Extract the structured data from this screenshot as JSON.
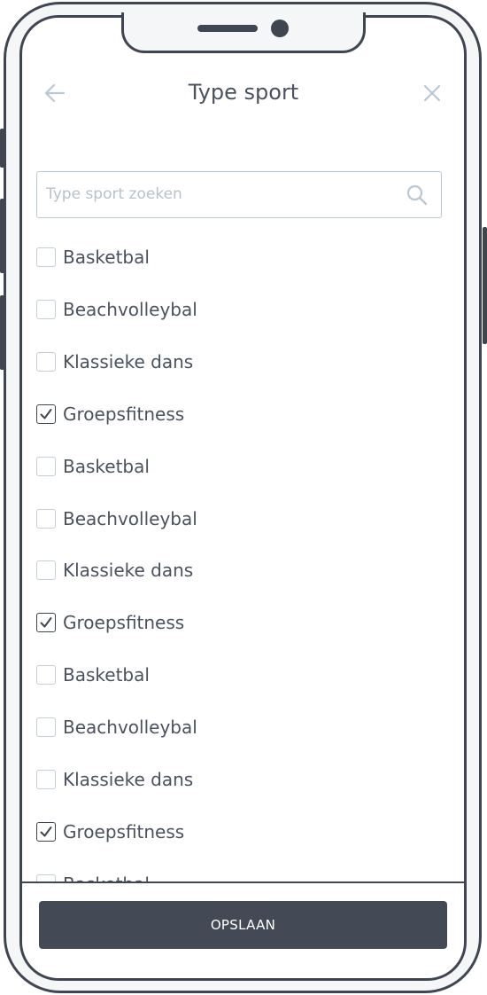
{
  "header": {
    "title": "Type sport",
    "back_icon": "arrow-left-icon",
    "close_icon": "close-icon"
  },
  "search": {
    "placeholder": "Type sport zoeken",
    "value": "",
    "icon": "search-icon"
  },
  "sports": [
    {
      "label": "Basketbal",
      "checked": false
    },
    {
      "label": "Beachvolleybal",
      "checked": false
    },
    {
      "label": "Klassieke dans",
      "checked": false
    },
    {
      "label": "Groepsfitness",
      "checked": true
    },
    {
      "label": "Basketbal",
      "checked": false
    },
    {
      "label": "Beachvolleybal",
      "checked": false
    },
    {
      "label": "Klassieke dans",
      "checked": false
    },
    {
      "label": "Groepsfitness",
      "checked": true
    },
    {
      "label": "Basketbal",
      "checked": false
    },
    {
      "label": "Beachvolleybal",
      "checked": false
    },
    {
      "label": "Klassieke dans",
      "checked": false
    },
    {
      "label": "Groepsfitness",
      "checked": true
    },
    {
      "label": "Basketbal",
      "checked": false
    }
  ],
  "footer": {
    "save_label": "OPSLAAN"
  },
  "colors": {
    "frame": "#3f4652",
    "button_bg": "#434a56",
    "text": "#4a5260",
    "icon_light": "#b9c8d2",
    "placeholder": "#b5c2cc"
  }
}
